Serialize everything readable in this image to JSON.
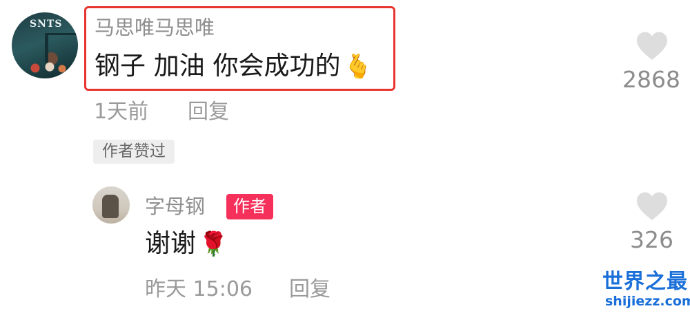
{
  "top_comment": {
    "username": "马思唯马思唯",
    "text": "钢子 加油 你会成功的",
    "emoji": "🫰",
    "time": "1天前",
    "reply_label": "回复",
    "author_liked_label": "作者赞过",
    "like_count": "2868",
    "avatar_text": "SNTS"
  },
  "reply_comment": {
    "username": "字母钢",
    "author_badge": "作者",
    "text": "谢谢",
    "emoji": "🌹",
    "time": "昨天 15:06",
    "reply_label": "回复",
    "like_count": "326"
  },
  "watermark": {
    "title": "世界之最",
    "url": "shijiezz.com"
  },
  "colors": {
    "highlight_border": "#e8342f",
    "author_badge": "#f5305a",
    "heart": "#dddddd",
    "watermark": "#1a6fd9"
  },
  "icons": {
    "like": "heart-icon"
  }
}
